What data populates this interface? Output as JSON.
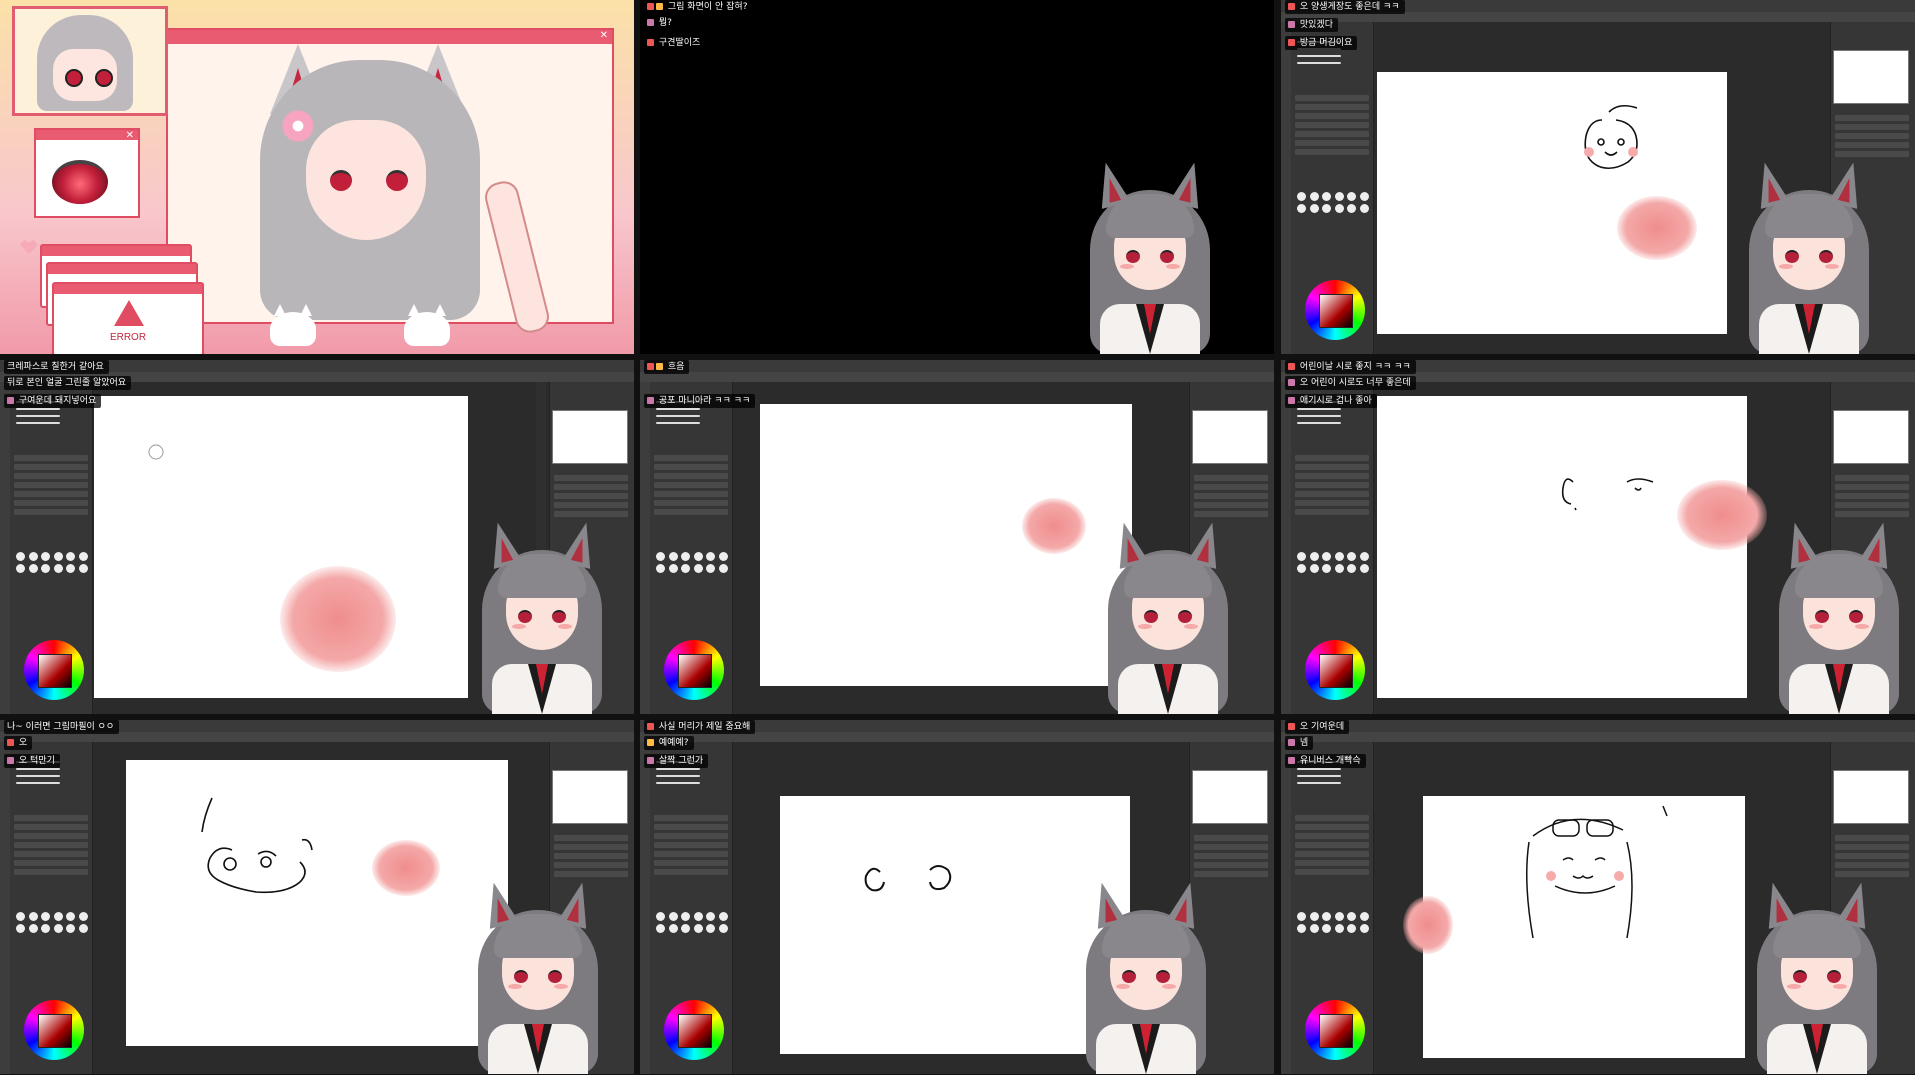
{
  "panel1": {
    "error_label": "ERROR"
  },
  "panel2": {
    "chat": [
      "그림 화면이 안 잡혀?",
      "뭥?",
      "구견딸이즈"
    ]
  },
  "panel3": {
    "chat": [
      "오 양생게장도 좋은데 ㅋㅋ",
      "맛있겠다",
      "방금 머김이요"
    ]
  },
  "panel4": {
    "chat": [
      "크레파스로 칠한거 같아요",
      "뒤로 본인 얼굴 그린줄 알았어요",
      "구여운데 돼지넣어요"
    ]
  },
  "panel5": {
    "chat": [
      "흐음",
      "공포 마니아라 ㅋㅋ ㅋㅋ"
    ]
  },
  "panel6": {
    "chat": [
      "어린이날 시로 좋지 ㅋㅋ ㅋㅋ",
      "오 어린이 시로도 너무 좋은데",
      "애기시로 겁나 좋아"
    ]
  },
  "panel7": {
    "chat": [
      "나~ 이러면 그림마필이 ㅇㅇ",
      "오",
      "오 턱만기"
    ]
  },
  "panel8": {
    "chat": [
      "사실 머리가 제일 중요해",
      "예예예?",
      "살짝 그런가"
    ]
  },
  "panel9": {
    "chat": [
      "오 기여운데",
      "넴",
      "유니버스 개빡슥"
    ]
  },
  "colors": {
    "app_bg": "#2b2b2b",
    "accent_pink": "#e04d62",
    "blush": "#f08d8d",
    "avatar_hair": "#7d7b80",
    "avatar_eye": "#b4203a"
  }
}
